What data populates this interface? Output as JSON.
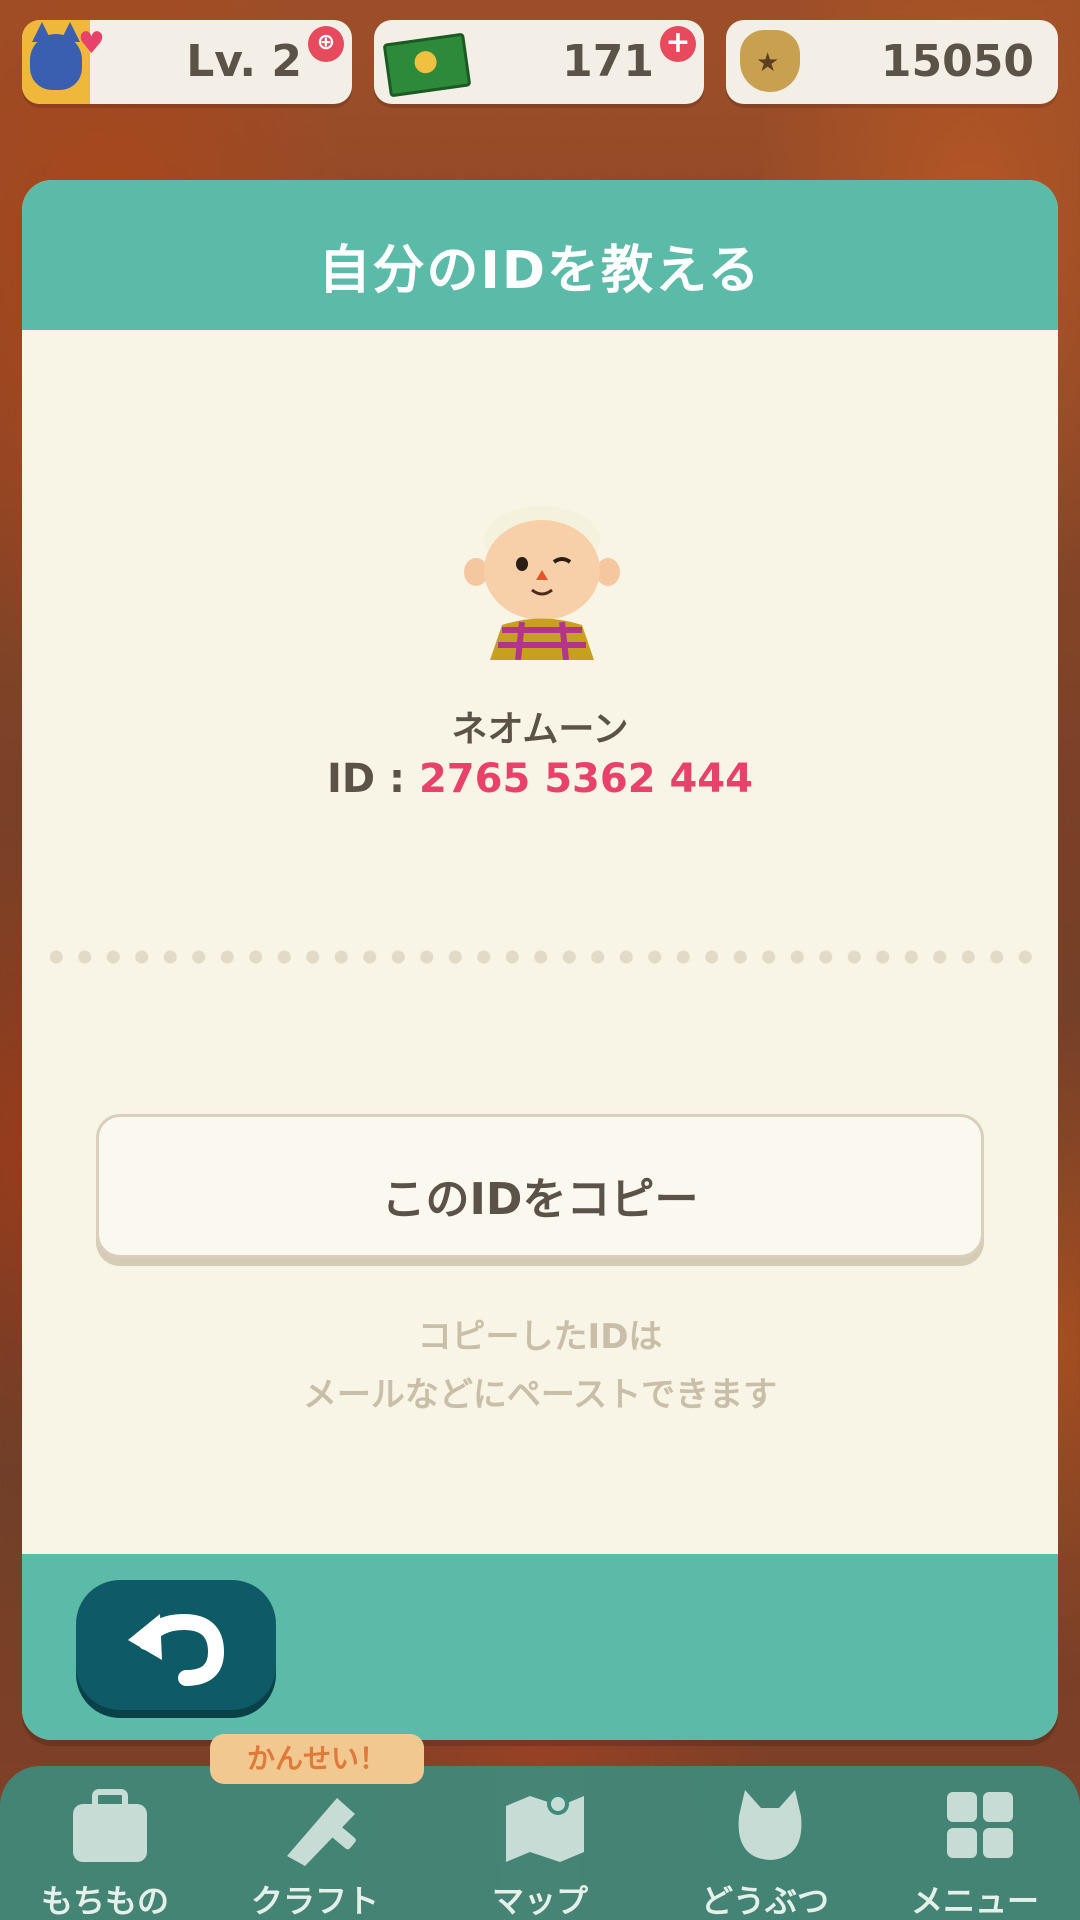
{
  "hud": {
    "level": "Lv. 2",
    "tickets": "171",
    "bells": "15050"
  },
  "modal": {
    "title": "自分のIDを教える",
    "character_name": "ネオムーン",
    "id_label": "ID : ",
    "id_value": "2765 5362 444",
    "copy_button": "このIDをコピー",
    "hint_line1": "コピーしたIDは",
    "hint_line2": "メールなどにペーストできます"
  },
  "nav": {
    "badge": "かんせい！",
    "items": [
      {
        "label": "もちもの"
      },
      {
        "label": "クラフト"
      },
      {
        "label": "マップ"
      },
      {
        "label": "どうぶつ"
      },
      {
        "label": "メニュー"
      }
    ]
  },
  "colors": {
    "teal": "#5bbba8",
    "back_button": "#0e5a66",
    "id_pink": "#e8426a",
    "panel_cream": "#f8f4e6"
  }
}
